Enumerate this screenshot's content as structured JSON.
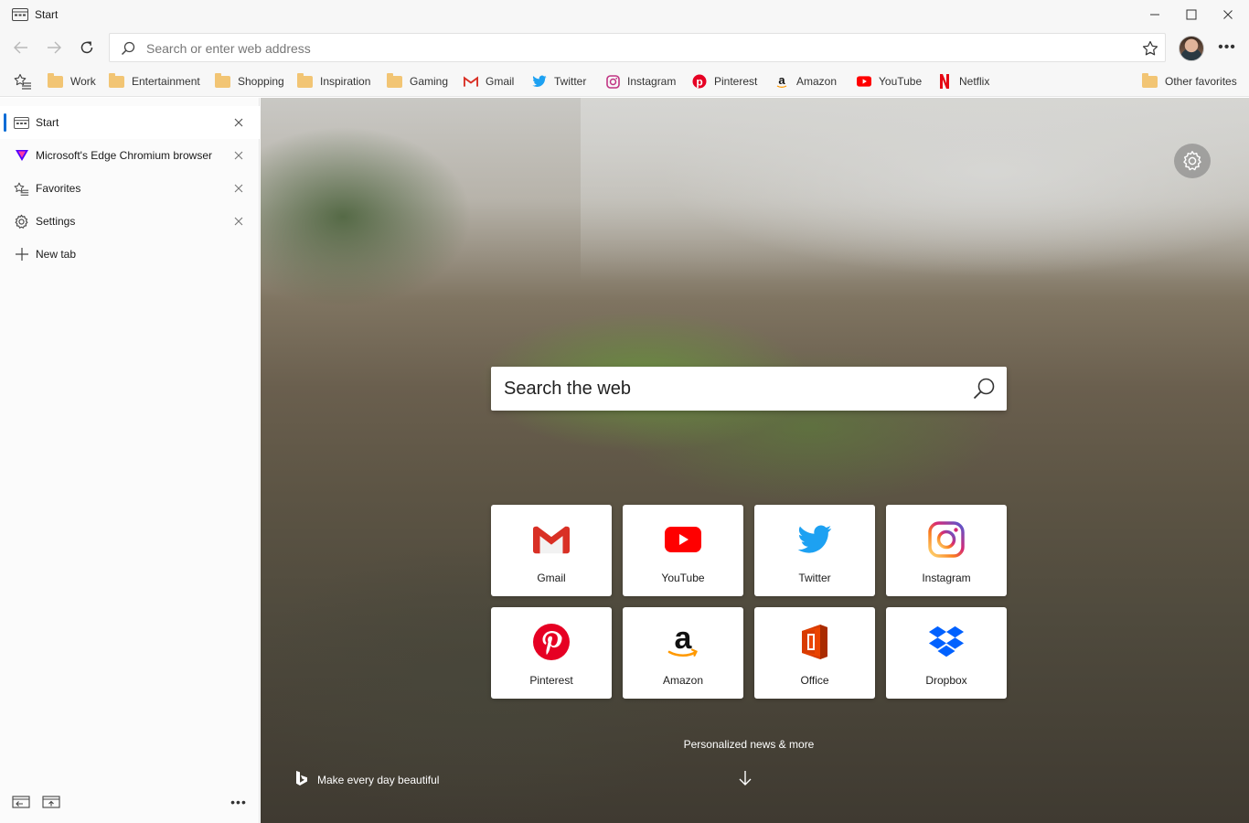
{
  "window": {
    "title": "Start",
    "controls": [
      "minimize",
      "maximize",
      "close"
    ]
  },
  "toolbar": {
    "address_placeholder": "Search or enter web address",
    "icons": [
      "back-icon",
      "forward-icon",
      "refresh-icon",
      "search-icon",
      "star-icon",
      "avatar",
      "more-icon"
    ]
  },
  "favorites_bar": {
    "items": [
      {
        "label": "Work",
        "icon": "folder-icon"
      },
      {
        "label": "Entertainment",
        "icon": "folder-icon"
      },
      {
        "label": "Shopping",
        "icon": "folder-icon"
      },
      {
        "label": "Inspiration",
        "icon": "folder-icon"
      },
      {
        "label": "Gaming",
        "icon": "folder-icon"
      },
      {
        "label": "Gmail",
        "icon": "gmail-icon"
      },
      {
        "label": "Twitter",
        "icon": "twitter-icon"
      },
      {
        "label": "Instagram",
        "icon": "instagram-icon"
      },
      {
        "label": "Pinterest",
        "icon": "pinterest-icon"
      },
      {
        "label": "Amazon",
        "icon": "amazon-icon"
      },
      {
        "label": "YouTube",
        "icon": "youtube-icon"
      },
      {
        "label": "Netflix",
        "icon": "netflix-icon"
      }
    ],
    "other": "Other favorites"
  },
  "sidebar": {
    "tabs": [
      {
        "label": "Start",
        "icon": "start-page-icon",
        "active": true
      },
      {
        "label": "Microsoft's Edge Chromium browser",
        "icon": "verge-icon",
        "active": false
      },
      {
        "label": "Favorites",
        "icon": "favorites-icon",
        "active": false
      },
      {
        "label": "Settings",
        "icon": "gear-icon",
        "active": false
      }
    ],
    "new_tab": "New tab"
  },
  "newtab": {
    "search_placeholder": "Search the web",
    "tiles": [
      {
        "label": "Gmail",
        "icon": "gmail-icon"
      },
      {
        "label": "YouTube",
        "icon": "youtube-icon"
      },
      {
        "label": "Twitter",
        "icon": "twitter-icon"
      },
      {
        "label": "Instagram",
        "icon": "instagram-icon"
      },
      {
        "label": "Pinterest",
        "icon": "pinterest-icon"
      },
      {
        "label": "Amazon",
        "icon": "amazon-icon"
      },
      {
        "label": "Office",
        "icon": "office-icon"
      },
      {
        "label": "Dropbox",
        "icon": "dropbox-icon"
      }
    ],
    "news_label": "Personalized news & more",
    "bing_caption": "Make every day beautiful"
  },
  "colors": {
    "accent": "#0a6cd6",
    "folder": "#f2c574",
    "gmail": "#d93025",
    "youtube": "#ff0000",
    "twitter": "#1da1f2",
    "pinterest": "#e60023",
    "netflix": "#e50914",
    "dropbox": "#0061ff",
    "office": "#d83b01"
  }
}
